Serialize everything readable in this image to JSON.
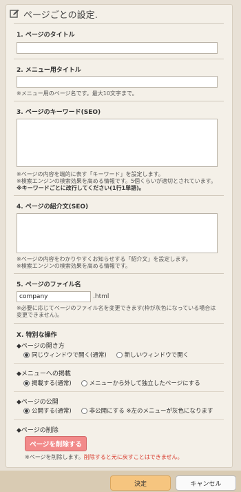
{
  "header": {
    "title": "ページごとの設定."
  },
  "sections": {
    "title": {
      "label": "1. ページのタイトル",
      "value": ""
    },
    "menu_title": {
      "label": "2. メニュー用タイトル",
      "value": "",
      "note": "※メニュー用のページ名です。最大10文字まで。"
    },
    "keywords": {
      "label": "3. ページのキーワード(SEO)",
      "note1": "※ページの内容を端的に表す「キーワード」を設定します。",
      "note2": "※検索エンジンの検索効果を高める情報です。5個くらいが適切とされています。",
      "note3": "※キーワードごとに改行してください(1行1単語)。"
    },
    "description": {
      "label": "4. ページの紹介文(SEO)",
      "note1": "※ページの内容をわかりやすくお知らせする「紹介文」を設定します。",
      "note2": "※検索エンジンの検索効果を高める情報です。"
    },
    "filename": {
      "label": "5. ページのファイル名",
      "value": "company",
      "suffix": ".html",
      "note1": "※必要に応じてページのファイル名を変更できます(枠が灰色になっている場合は",
      "note2": "変更できません)。"
    },
    "special": {
      "label": "X. 特別な操作",
      "open_method": {
        "title": "◆ページの開き方",
        "opt1": "同じウィンドウで開く(通常)",
        "opt2": "新しいウィンドウで開く"
      },
      "menu_listing": {
        "title": "◆メニューへの掲載",
        "opt1": "掲載する(通常)",
        "opt2": "メニューから外して独立したページにする"
      },
      "publish": {
        "title": "◆ページの公開",
        "opt1": "公開する(通常)",
        "opt2": "非公開にする ※左のメニューが灰色になります"
      },
      "delete": {
        "title": "◆ページの削除",
        "button": "ページを削除する",
        "warn_prefix": "※ページを削除します。",
        "warn_red": "削除すると元に戻すことはできません。"
      }
    }
  },
  "footer": {
    "ok": "決定",
    "cancel": "キャンセル"
  }
}
